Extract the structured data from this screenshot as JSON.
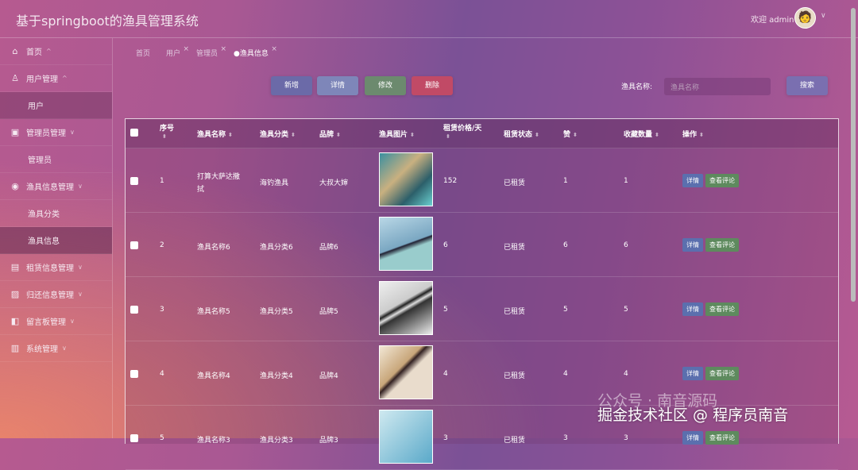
{
  "header": {
    "title": "基于springboot的渔具管理系统",
    "welcome": "欢迎 admin",
    "avatar": "🧑"
  },
  "sidebar": {
    "items": [
      {
        "label": "首页",
        "icon": "home-icon",
        "glyph": "⌂",
        "type": "top"
      },
      {
        "label": "用户管理",
        "icon": "user-icon",
        "glyph": "♙",
        "type": "top"
      },
      {
        "label": "用户",
        "type": "sub",
        "style": "dark"
      },
      {
        "label": "管理员管理",
        "icon": "image-icon",
        "glyph": "▣",
        "type": "top"
      },
      {
        "label": "管理员",
        "type": "sub"
      },
      {
        "label": "渔具信息管理",
        "icon": "compass-icon",
        "glyph": "◉",
        "type": "top"
      },
      {
        "label": "渔具分类",
        "type": "sub"
      },
      {
        "label": "渔具信息",
        "type": "sub",
        "style": "active"
      },
      {
        "label": "租赁信息管理",
        "icon": "gift-icon",
        "glyph": "▤",
        "type": "top"
      },
      {
        "label": "归还信息管理",
        "icon": "picture-icon",
        "glyph": "▨",
        "type": "top"
      },
      {
        "label": "留言板管理",
        "icon": "layout-icon",
        "glyph": "◧",
        "type": "top"
      },
      {
        "label": "系统管理",
        "icon": "grid-icon",
        "glyph": "▥",
        "type": "top"
      }
    ]
  },
  "tabs": [
    {
      "label": "首页",
      "closable": false
    },
    {
      "label": "用户",
      "closable": true
    },
    {
      "label": "管理员",
      "closable": true
    },
    {
      "label": "●渔具信息",
      "closable": true,
      "active": true
    }
  ],
  "toolbar": {
    "add": "新增",
    "detail": "详情",
    "edit": "修改",
    "delete": "删除",
    "search_label": "渔具名称:",
    "search_placeholder": "渔具名称",
    "search": "搜索"
  },
  "colors": {
    "add": "#6b6aa8",
    "detail": "#7e86b9",
    "edit": "#6c8a6e",
    "delete": "#c14a66",
    "op_detail": "#5b6fae",
    "op_review": "#5e8a5e"
  },
  "table": {
    "headers": [
      "序号",
      "渔具名称",
      "渔具分类",
      "品牌",
      "渔具图片",
      "租赁价格/天",
      "租赁状态",
      "赞",
      "收藏数量",
      "操作"
    ],
    "rows": [
      {
        "no": "1",
        "name": "打算大萨达撒拭",
        "category": "海钓渔具",
        "brand": "大叔大婶",
        "price": "152",
        "status": "已租赁",
        "likes": "1",
        "favs": "1"
      },
      {
        "no": "2",
        "name": "渔具名称6",
        "category": "渔具分类6",
        "brand": "品牌6",
        "price": "6",
        "status": "已租赁",
        "likes": "6",
        "favs": "6"
      },
      {
        "no": "3",
        "name": "渔具名称5",
        "category": "渔具分类5",
        "brand": "品牌5",
        "price": "5",
        "status": "已租赁",
        "likes": "5",
        "favs": "5"
      },
      {
        "no": "4",
        "name": "渔具名称4",
        "category": "渔具分类4",
        "brand": "品牌4",
        "price": "4",
        "status": "已租赁",
        "likes": "4",
        "favs": "4"
      },
      {
        "no": "5",
        "name": "渔具名称3",
        "category": "渔具分类3",
        "brand": "品牌3",
        "price": "3",
        "status": "已租赁",
        "likes": "3",
        "favs": "3"
      }
    ],
    "op_detail": "详情",
    "op_review": "查看评论"
  },
  "watermark": {
    "line1": "公众号 · 南音源码",
    "line2": "掘金技术社区 @ 程序员南音"
  }
}
